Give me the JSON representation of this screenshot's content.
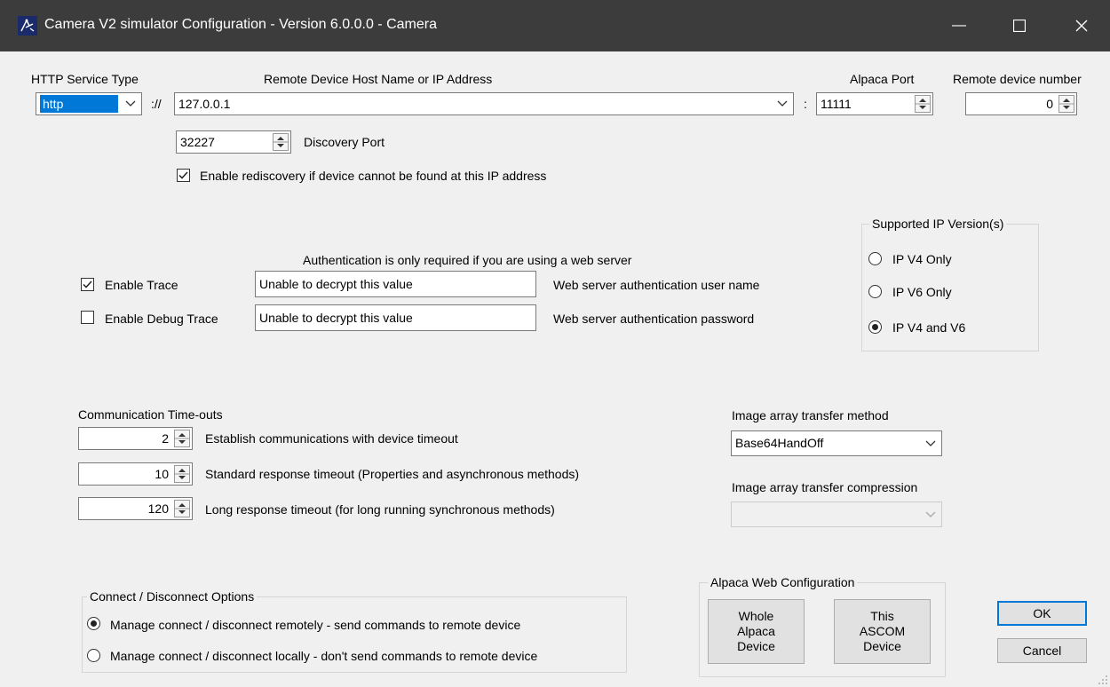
{
  "window": {
    "title": "Camera V2 simulator Configuration - Version 6.0.0.0 - Camera",
    "minimize_glyph": "—",
    "maximize_glyph": "☐",
    "close_glyph": "✕"
  },
  "connection": {
    "http_service_type_label": "HTTP Service Type",
    "http_service_type_value": "http",
    "scheme_separator": "://",
    "host_label": "Remote Device Host Name or IP Address",
    "host_value": "127.0.0.1",
    "port_separator": ":",
    "alpaca_port_label": "Alpaca Port",
    "alpaca_port_value": "11111",
    "remote_device_number_label": "Remote device number",
    "remote_device_number_value": "0",
    "discovery_port_value": "32227",
    "discovery_port_label": "Discovery Port",
    "rediscovery_label": "Enable rediscovery if device cannot be found at this IP address",
    "rediscovery_checked": true
  },
  "ip_version": {
    "group_label": "Supported IP Version(s)",
    "options": [
      "IP V4 Only",
      "IP V6 Only",
      "IP V4 and V6"
    ],
    "selected": "IP V4 and V6"
  },
  "auth": {
    "note": "Authentication is only required if you are using a web server",
    "username_value": "Unable to decrypt this value",
    "username_label": "Web server authentication user name",
    "password_value": "Unable to decrypt this value",
    "password_label": "Web server authentication password"
  },
  "trace": {
    "enable_trace_label": "Enable Trace",
    "enable_trace_checked": true,
    "enable_debug_trace_label": "Enable Debug Trace",
    "enable_debug_trace_checked": false
  },
  "timeouts": {
    "heading": "Communication Time-outs",
    "establish_value": "2",
    "establish_label": "Establish communications with device timeout",
    "standard_value": "10",
    "standard_label": "Standard response timeout (Properties and asynchronous methods)",
    "long_value": "120",
    "long_label": "Long response timeout (for long running synchronous methods)"
  },
  "image_array": {
    "method_label": "Image array transfer method",
    "method_value": "Base64HandOff",
    "compression_label": "Image array transfer compression",
    "compression_value": ""
  },
  "connect_options": {
    "group_label": "Connect / Disconnect Options",
    "remote_label": "Manage connect / disconnect remotely - send commands to remote device",
    "local_label": "Manage connect / disconnect locally - don't send commands to remote device",
    "selected": "remote"
  },
  "alpaca_web": {
    "group_label": "Alpaca Web Configuration",
    "whole_device_lines": [
      "Whole",
      "Alpaca",
      "Device"
    ],
    "this_device_lines": [
      "This",
      "ASCOM",
      "Device"
    ]
  },
  "buttons": {
    "ok": "OK",
    "cancel": "Cancel"
  },
  "colors": {
    "titlebar": "#3c3c3c",
    "dialog_bg": "#f0f0f0",
    "selection": "#0078d7",
    "ok_border": "#0078d7"
  }
}
